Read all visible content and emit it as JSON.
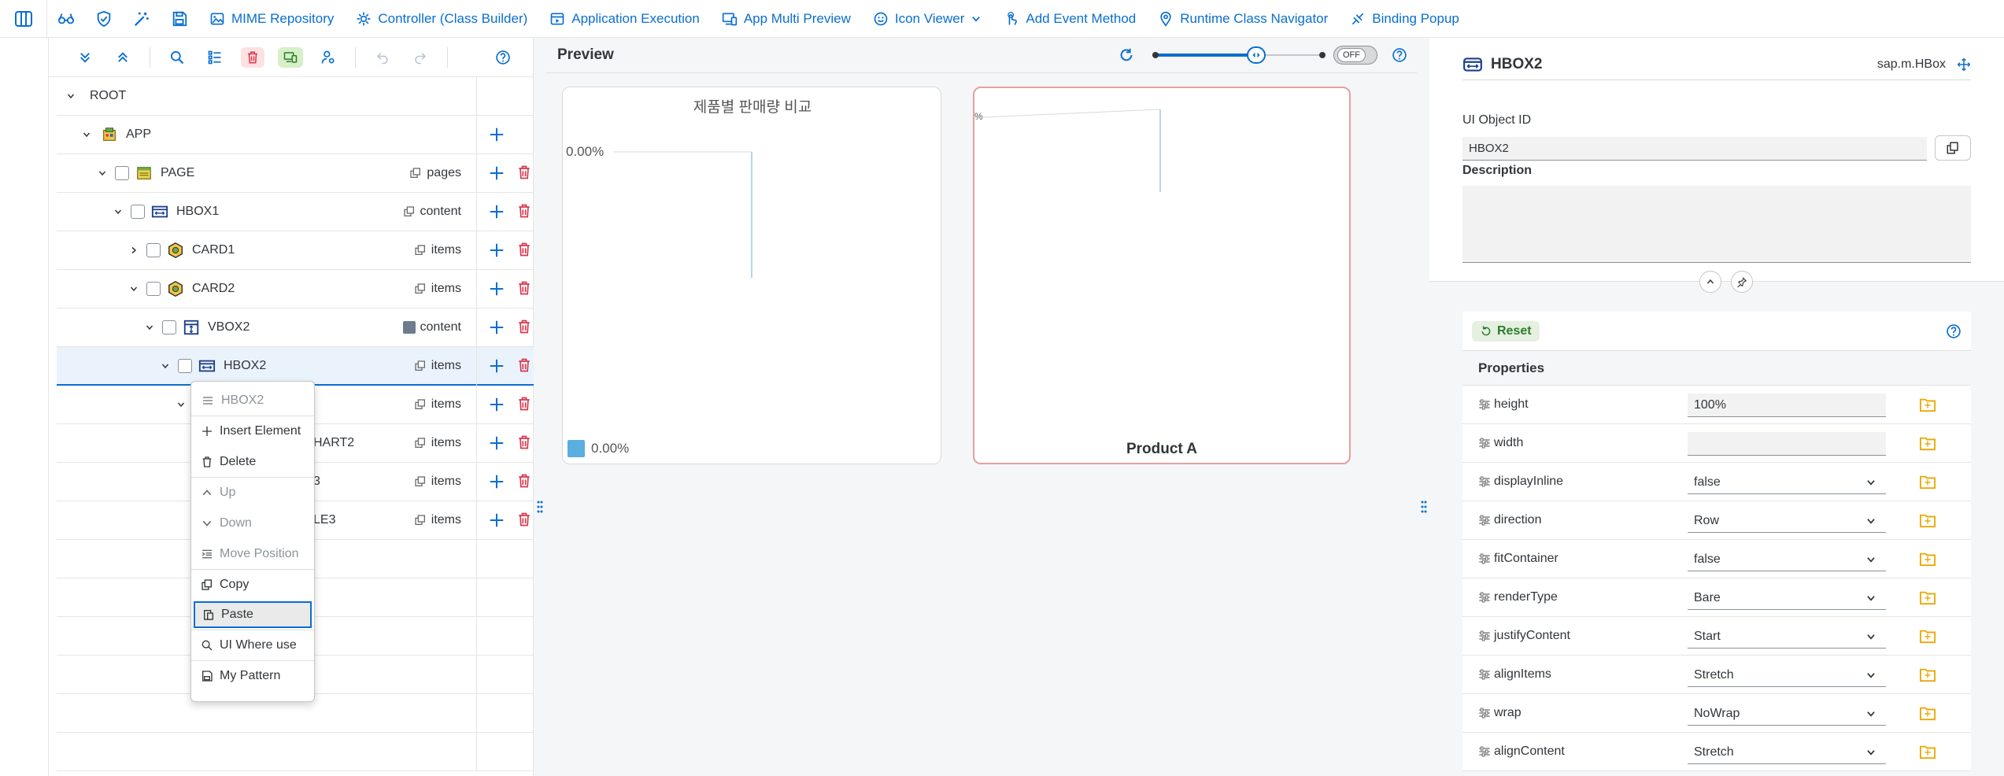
{
  "topbar": {
    "links": [
      {
        "label": "MIME Repository",
        "icon": "image-icon"
      },
      {
        "label": "Controller (Class Builder)",
        "icon": "gear-icon"
      },
      {
        "label": "Application Execution",
        "icon": "run-icon"
      },
      {
        "label": "App Multi Preview",
        "icon": "devices-icon"
      },
      {
        "label": "Icon Viewer",
        "icon": "smiley-icon"
      },
      {
        "label": "Add Event Method",
        "icon": "touch-icon"
      },
      {
        "label": "Runtime Class Navigator",
        "icon": "location-icon"
      },
      {
        "label": "Binding Popup",
        "icon": "link-icon"
      }
    ]
  },
  "tree": {
    "rows": [
      {
        "label": "ROOT"
      },
      {
        "label": "APP"
      },
      {
        "label": "PAGE",
        "agg": "pages"
      },
      {
        "label": "HBOX1",
        "agg": "content"
      },
      {
        "label": "CARD1",
        "agg": "items"
      },
      {
        "label": "CARD2",
        "agg": "items"
      },
      {
        "label": "VBOX2",
        "agg": "content"
      },
      {
        "label": "HBOX2",
        "agg": "items"
      },
      {
        "label": "",
        "agg": "items"
      },
      {
        "label": "HART2",
        "agg": "items"
      },
      {
        "label": "3",
        "agg": "items"
      },
      {
        "label": "LE3",
        "agg": "items"
      }
    ]
  },
  "context_menu": {
    "header": "HBOX2",
    "items": {
      "insert": "Insert Element",
      "delete": "Delete",
      "up": "Up",
      "down": "Down",
      "move": "Move Position",
      "copy": "Copy",
      "paste": "Paste",
      "where_use": "UI Where use",
      "pattern": "My Pattern"
    }
  },
  "preview": {
    "title": "Preview",
    "toggle": "OFF",
    "slider_level": 0.6,
    "card1": {
      "title": "제품별 판매량 비교",
      "axis_label": "0.00%",
      "legend_value": "0.00%",
      "legend_color": "#5aaee0"
    },
    "card2": {
      "axis_label": "%",
      "caption": "Product A"
    }
  },
  "props": {
    "object_name": "HBOX2",
    "object_class": "sap.m.HBox",
    "id_label": "UI Object ID",
    "id_value": "HBOX2",
    "desc_label": "Description",
    "reset_label": "Reset",
    "section_title": "Properties",
    "rows": [
      {
        "name": "height",
        "value": "100%",
        "kind": "input"
      },
      {
        "name": "width",
        "value": "",
        "kind": "input"
      },
      {
        "name": "displayInline",
        "value": "false",
        "kind": "select"
      },
      {
        "name": "direction",
        "value": "Row",
        "kind": "select"
      },
      {
        "name": "fitContainer",
        "value": "false",
        "kind": "select"
      },
      {
        "name": "renderType",
        "value": "Bare",
        "kind": "select"
      },
      {
        "name": "justifyContent",
        "value": "Start",
        "kind": "select"
      },
      {
        "name": "alignItems",
        "value": "Stretch",
        "kind": "select"
      },
      {
        "name": "wrap",
        "value": "NoWrap",
        "kind": "select"
      },
      {
        "name": "alignContent",
        "value": "Stretch",
        "kind": "select"
      }
    ]
  },
  "colors": {
    "accent": "#0a6ed1",
    "danger": "#d9364c",
    "add": "#0a6ed1"
  }
}
